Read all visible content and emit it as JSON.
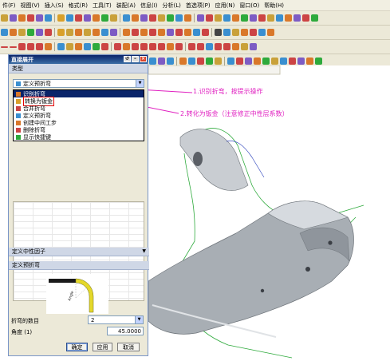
{
  "menu": [
    "件(F)",
    "视图(V)",
    "插入(S)",
    "格式(R)",
    "工具(T)",
    "装配(A)",
    "信息(I)",
    "分析(L)",
    "首选项(P)",
    "应用(N)",
    "窗口(O)",
    "帮助(H)"
  ],
  "dialog": {
    "title": "直接展开",
    "type_section": "类型",
    "type_selected": "定义预折弯",
    "type_options": [
      {
        "label": "识别折弯",
        "state": "selected"
      },
      {
        "label": "转换为钣金",
        "state": "boxed"
      },
      {
        "label": "合并折弯",
        "state": "normal"
      },
      {
        "label": "定义预折弯",
        "state": "normal"
      },
      {
        "label": "创建中间工步",
        "state": "normal"
      },
      {
        "label": "删除折弯",
        "state": "normal"
      },
      {
        "label": "显示快捷键",
        "state": "normal"
      }
    ],
    "neutral_section": "定义中性因子",
    "prebend_section": "定义预折弯",
    "angle_label_in_image": "Angle",
    "bend_count_label": "折弯的数目",
    "bend_count_value": "2",
    "angle_label": "角度 (1)",
    "angle_value": "45.0000",
    "ok": "确定",
    "apply": "应用",
    "cancel": "取消"
  },
  "annotations": {
    "step1": "1.识别折弯，按提示操作",
    "step2": "2.转化为钣金（注意修正中性层系数）",
    "color": "#e020c0"
  },
  "colors": {
    "titlebar": "#0a246a",
    "selection": "#0a246a",
    "model_gray": "#a8aeb4",
    "edge_green": "#2eaa3c"
  }
}
